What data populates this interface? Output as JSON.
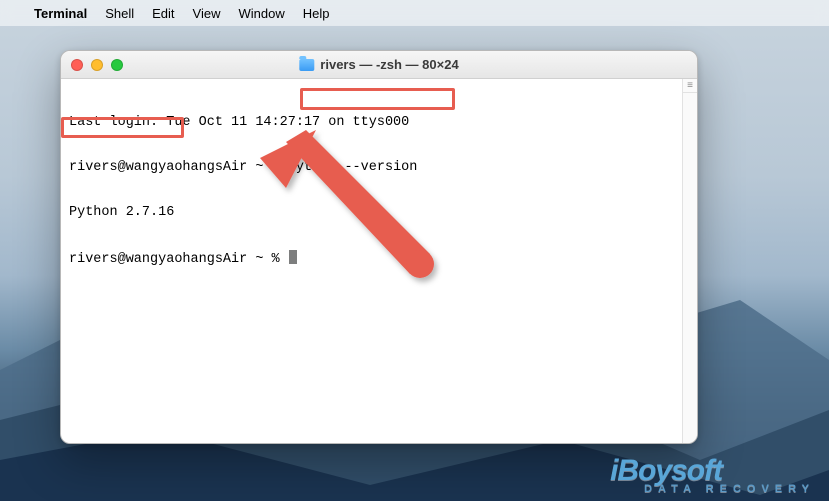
{
  "menubar": {
    "apple": "",
    "app": "Terminal",
    "items": [
      "Shell",
      "Edit",
      "View",
      "Window",
      "Help"
    ]
  },
  "window": {
    "title": "rivers — -zsh — 80×24"
  },
  "terminal": {
    "line1_prefix": "Last login: Tue Oct 11 14:",
    "line1_obscured": "27:17 on ttys000",
    "prompt_host": "rivers@wangyaohangsAir",
    "prompt_sep": " ~ % ",
    "cmd": "Python --version",
    "output": "Python 2.7.16",
    "prompt2_host": "rivers@wangyaohangsAir",
    "prompt2_sep": " ~ % "
  },
  "annotation": {
    "highlight_cmd": "Python --version",
    "highlight_output": "Python 2.7.16",
    "color": "#e75d50"
  },
  "watermark": {
    "brand": "iBoysoft",
    "tag": "DATA RECOVERY"
  }
}
